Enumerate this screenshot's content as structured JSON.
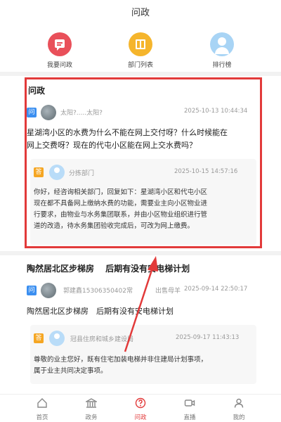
{
  "header": {
    "title": "问政"
  },
  "actions": [
    {
      "label": "我要问政",
      "icon": "message-icon"
    },
    {
      "label": "部门列表",
      "icon": "list-icon"
    },
    {
      "label": "排行榜",
      "icon": "ranking-icon"
    }
  ],
  "card1": {
    "title": "问政",
    "badge_question": "问",
    "author": "太阳?.....太阳?",
    "time": "2025-10-13 10:44:34",
    "question_lines": [
      "星湖湾小区的水费为什么不能在网上交付呀？什么时候能在",
      "网上交费呀？现在的代屯小区能在网上交水费吗？"
    ],
    "badge_answer": "答",
    "reply_dept": "分拣部门",
    "reply_time": "2025-10-15 14:57:16",
    "reply_lines": [
      "你好，经咨询相关部门，回复如下：星湖湾小区和代屯小区",
      "现在都不具备网上缴纳水费的功能，需要业主向小区物业进",
      "行要求，由物业与水务集团联系，并由小区物业组织进行管",
      "道的改造，待水务集团验收完成后，可改为网上缴费。"
    ]
  },
  "card2": {
    "title": "陶然居北区步梯房　 后期有没有安电梯计划",
    "badge_question": "问",
    "author": "郭建鑫15306350402常",
    "author_tail": "出售母羊",
    "time": "2025-09-14 22:50:17",
    "question": "陶然居北区步梯房　后期有没有安电梯计划",
    "badge_answer": "答",
    "reply_dept": "冠县住房和城乡建设局",
    "reply_time": "2025-09-17 11:43:13",
    "reply_lines": [
      "尊敬的业主您好，既有住宅加装电梯并非住建局计划事项，",
      "属于业主共同决定事项。"
    ]
  },
  "nav": [
    {
      "label": "首页",
      "icon": "home-icon",
      "active": false
    },
    {
      "label": "政务",
      "icon": "government-icon",
      "active": false
    },
    {
      "label": "问政",
      "icon": "question-icon",
      "active": true
    },
    {
      "label": "直播",
      "icon": "video-icon",
      "active": false
    },
    {
      "label": "我的",
      "icon": "profile-icon",
      "active": false
    }
  ],
  "colors": {
    "accent": "#e23a3a",
    "question_badge": "#3b8ff0",
    "answer_badge": "#f5a623"
  }
}
